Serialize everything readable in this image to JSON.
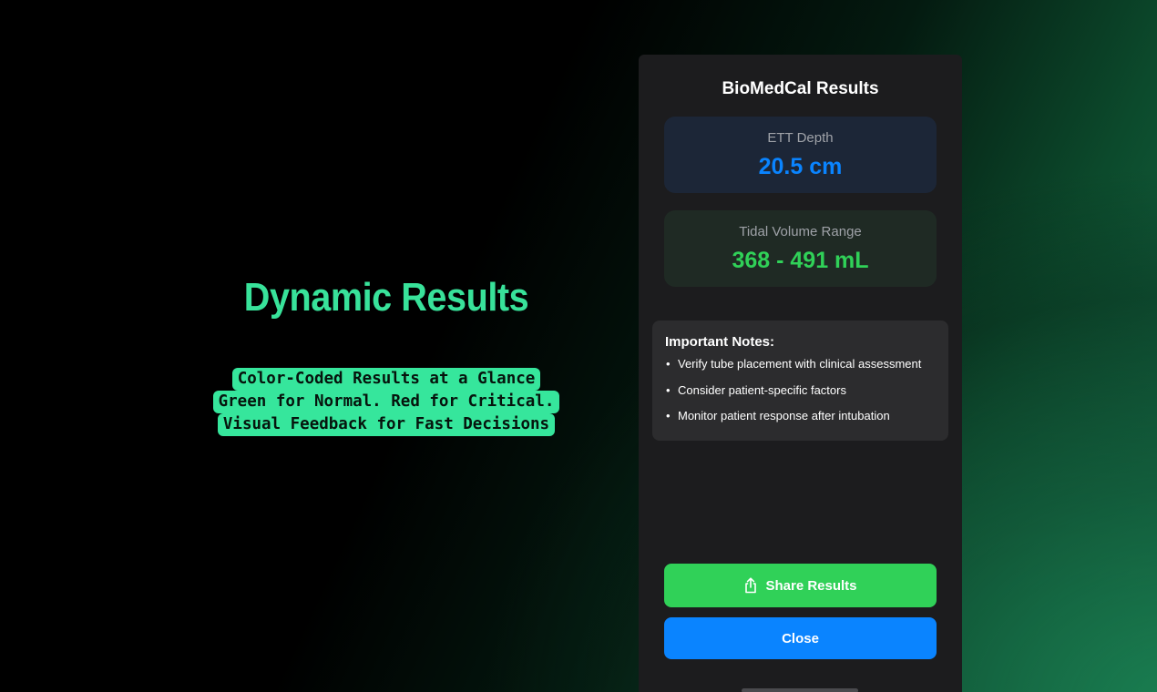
{
  "promo": {
    "title": "Dynamic Results",
    "lines": [
      "Color-Coded Results at a Glance",
      "Green for Normal. Red for Critical.",
      "Visual Feedback for Fast Decisions"
    ]
  },
  "app": {
    "title": "BioMedCal Results",
    "ett": {
      "label": "ETT Depth",
      "value": "20.5 cm"
    },
    "tidal_volume": {
      "label": "Tidal Volume Range",
      "value": "368 - 491 mL"
    },
    "notes": {
      "title": "Important Notes:",
      "items": [
        "Verify tube placement with clinical assessment",
        "Consider patient-specific factors",
        "Monitor patient response after intubation"
      ]
    },
    "share_label": "Share Results",
    "close_label": "Close",
    "icons": {
      "share": "share-icon"
    }
  },
  "colors": {
    "accent_green": "#30d158",
    "accent_blue": "#0a84ff",
    "promo_green": "#36e69c"
  }
}
